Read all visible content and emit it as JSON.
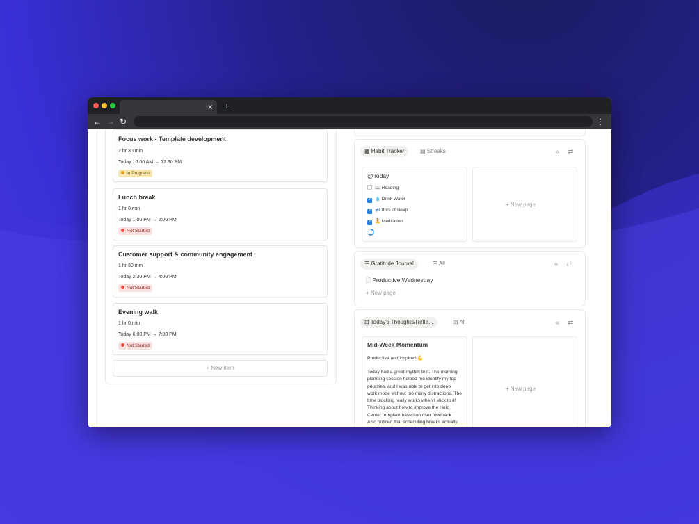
{
  "browser": {
    "colors": {
      "close": "#ff5f57",
      "minimize": "#febc2e",
      "maximize": "#28c840"
    },
    "tab_close_label": "×",
    "new_tab_label": "+",
    "back_label": "←",
    "forward_label": "→",
    "reload_label": "↻",
    "menu_label": "⋮"
  },
  "schedule": {
    "items": [
      {
        "title": "Focus work - Template development",
        "duration": "2 hr 30 min",
        "time": "Today 10:00 AM → 12:30 PM",
        "status": "In Progress"
      },
      {
        "title": "Lunch break",
        "duration": "1 hr 0 min",
        "time": "Today 1:00 PM → 2:00 PM",
        "status": "Not Started"
      },
      {
        "title": "Customer support & community engagement",
        "duration": "1 hr 30 min",
        "time": "Today 2:30 PM → 4:00 PM",
        "status": "Not Started"
      },
      {
        "title": "Evening walk",
        "duration": "1 hr 0 min",
        "time": "Today 6:00 PM → 7:00 PM",
        "status": "Not Started"
      }
    ],
    "new_item_label": "+  New item"
  },
  "habit_tracker": {
    "tab_active": "Habit Tracker",
    "tab_other": "Streaks",
    "icon_collapse": "«",
    "icon_settings": "⇄",
    "card_title": "@Today",
    "habits": [
      {
        "label": "📖 Reading",
        "checked": false
      },
      {
        "label": "💧 Drink Water",
        "checked": true
      },
      {
        "label": "💤 8hrs of sleep",
        "checked": true
      },
      {
        "label": "🧘 Meditation",
        "checked": true
      }
    ],
    "new_page_label": "+  New page"
  },
  "gratitude_journal": {
    "tab_active": "Gratitude Journal",
    "tab_other": "All",
    "entry": "Productive Wednesday",
    "new_page_label": "+  New page"
  },
  "thoughts": {
    "tab_active": "Today's Thoughts/Refle...",
    "tab_other": "All",
    "card_title": "Mid-Week Momentum",
    "mood": "Productive and inspired 💪",
    "body": "Today had a great rhythm to it. The morning planning session helped me identify my top priorities, and I was able to get into deep work mode without too many distractions. The time blocking really works when I stick to it! Thinking about how to improve the Help Center template based on user feedback. Also noticed that scheduling breaks actually",
    "new_page_label": "+  New page"
  }
}
